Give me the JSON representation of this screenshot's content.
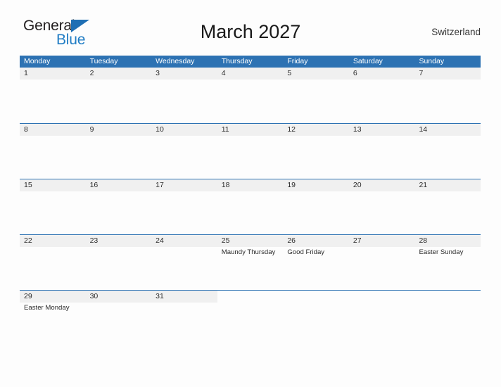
{
  "brand": {
    "name_part1": "General",
    "name_part2": "Blue",
    "flag_icon": "blue-triangle-flag-icon",
    "color_dark": "#231f20",
    "color_blue": "#1f7cc4"
  },
  "header": {
    "title": "March 2027",
    "country": "Switzerland",
    "header_bg": "#2d72b3"
  },
  "calendar": {
    "weekdays": [
      "Monday",
      "Tuesday",
      "Wednesday",
      "Thursday",
      "Friday",
      "Saturday",
      "Sunday"
    ],
    "weeks": [
      {
        "days": [
          {
            "num": "1",
            "events": []
          },
          {
            "num": "2",
            "events": []
          },
          {
            "num": "3",
            "events": []
          },
          {
            "num": "4",
            "events": []
          },
          {
            "num": "5",
            "events": []
          },
          {
            "num": "6",
            "events": []
          },
          {
            "num": "7",
            "events": []
          }
        ]
      },
      {
        "days": [
          {
            "num": "8",
            "events": []
          },
          {
            "num": "9",
            "events": []
          },
          {
            "num": "10",
            "events": []
          },
          {
            "num": "11",
            "events": []
          },
          {
            "num": "12",
            "events": []
          },
          {
            "num": "13",
            "events": []
          },
          {
            "num": "14",
            "events": []
          }
        ]
      },
      {
        "days": [
          {
            "num": "15",
            "events": []
          },
          {
            "num": "16",
            "events": []
          },
          {
            "num": "17",
            "events": []
          },
          {
            "num": "18",
            "events": []
          },
          {
            "num": "19",
            "events": []
          },
          {
            "num": "20",
            "events": []
          },
          {
            "num": "21",
            "events": []
          }
        ]
      },
      {
        "days": [
          {
            "num": "22",
            "events": []
          },
          {
            "num": "23",
            "events": []
          },
          {
            "num": "24",
            "events": []
          },
          {
            "num": "25",
            "events": [
              "Maundy Thursday"
            ]
          },
          {
            "num": "26",
            "events": [
              "Good Friday"
            ]
          },
          {
            "num": "27",
            "events": []
          },
          {
            "num": "28",
            "events": [
              "Easter Sunday"
            ]
          }
        ]
      },
      {
        "days": [
          {
            "num": "29",
            "events": [
              "Easter Monday"
            ]
          },
          {
            "num": "30",
            "events": []
          },
          {
            "num": "31",
            "events": []
          },
          {
            "num": "",
            "events": []
          },
          {
            "num": "",
            "events": []
          },
          {
            "num": "",
            "events": []
          },
          {
            "num": "",
            "events": []
          }
        ]
      }
    ]
  }
}
